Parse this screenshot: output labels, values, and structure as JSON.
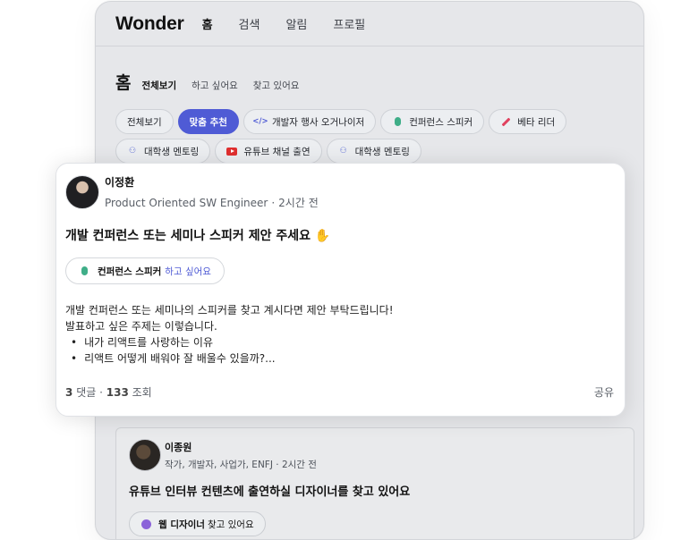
{
  "app": {
    "logo": "Wonder"
  },
  "nav": [
    "홈",
    "검색",
    "알림",
    "프로필"
  ],
  "page": {
    "title": "홈",
    "segments": [
      "전체보기",
      "하고 싶어요",
      "찾고 있어요"
    ]
  },
  "chips": [
    {
      "label": "전체보기",
      "icon": ""
    },
    {
      "label": "맞춤 추천",
      "icon": "",
      "active": true
    },
    {
      "label": "개발자 행사 오거나이저",
      "icon": "code-icon"
    },
    {
      "label": "컨퍼런스 스피커",
      "icon": "microphone-icon"
    },
    {
      "label": "베타 리더",
      "icon": "pen-icon"
    },
    {
      "label": "대학생 멘토링",
      "icon": "users-icon"
    },
    {
      "label": "유튜브 채널 출연",
      "icon": "youtube-icon"
    },
    {
      "label": "대학생 멘토링",
      "icon": "users-icon"
    }
  ],
  "post": {
    "author": "이정환",
    "role": "Product Oriented SW Engineer",
    "time": "2시간 전",
    "title": "개발 컨퍼런스 또는 세미나 스피커 제안 주세요",
    "tag_keyword": "컨퍼런스 스피커",
    "tag_status": "하고 싶어요",
    "body_lines": [
      "개발 컨퍼런스 또는 세미나의 스피커를 찾고 계시다면 제안 부탁드립니다!",
      "발표하고 싶은 주제는 이렇습니다."
    ],
    "bullets": [
      "내가 리액트를 사랑하는 이유",
      "리액트 어떻게 배워야 잘 배울수 있을까?..."
    ],
    "comments_count": "3",
    "comments_label": "댓글",
    "views_count": "133",
    "views_label": "조회",
    "share_label": "공유"
  },
  "post2": {
    "author": "이종원",
    "role": "작가, 개발자, 사업가, ENFJ",
    "time": "2시간 전",
    "title": "유튜브 인터뷰 컨텐츠에 출연하실 디자이너를 찾고 있어요",
    "tag_keyword": "웹 디자이너",
    "tag_status": "찾고 있어요"
  },
  "colors": {
    "accent": "#4f5bd5",
    "mic": "#3fae88",
    "youtube": "#e02f2f"
  }
}
